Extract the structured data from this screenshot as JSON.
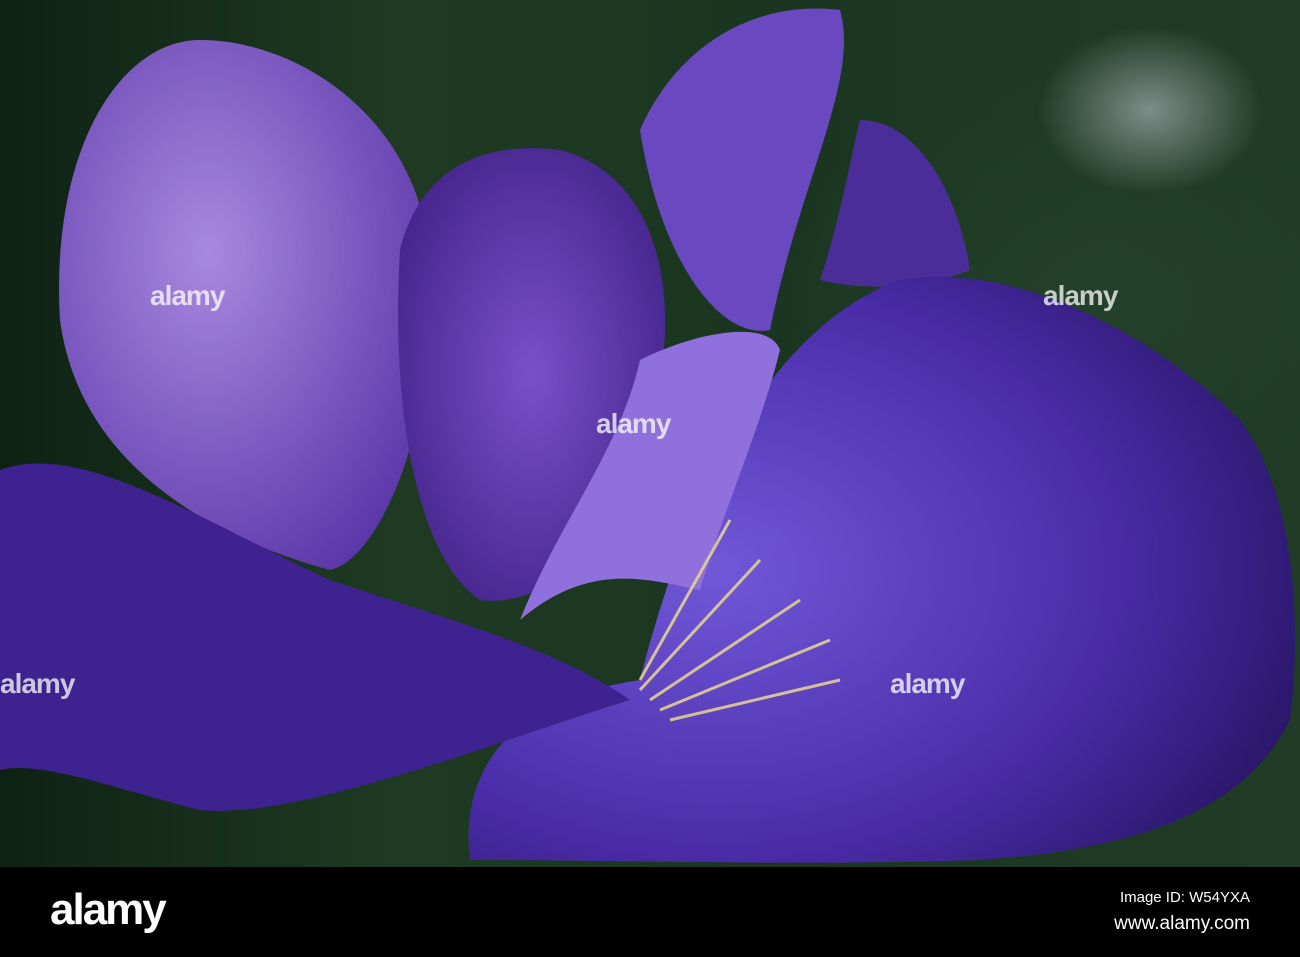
{
  "image": {
    "subject": "purple iris flower close-up",
    "accent": "#5a2fb0"
  },
  "watermark": {
    "text": "alamy"
  },
  "footer": {
    "logo": "alamy",
    "image_id": "Image ID: W54YXA",
    "url": "www.alamy.com"
  }
}
